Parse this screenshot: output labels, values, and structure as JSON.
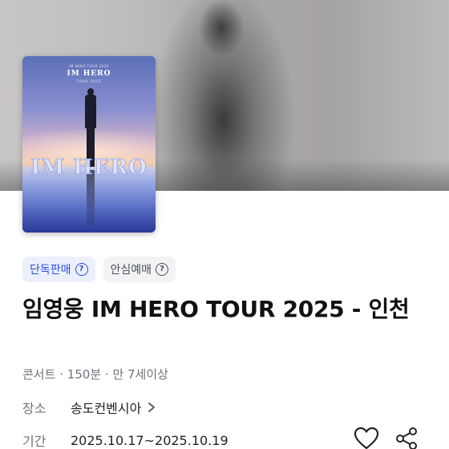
{
  "poster": {
    "top_line": "IM HERO TOUR 2025",
    "title_top": "IM HERO",
    "subtitle": "TOUR 2025",
    "title_big": "IM HERO"
  },
  "badges": {
    "exclusive_label": "단독판매",
    "safe_label": "안심예매"
  },
  "concert": {
    "title": "임영웅 IM HERO TOUR 2025 - 인천",
    "meta": "콘서트 · 150분 · 만 7세이상"
  },
  "info": {
    "place_label": "장소",
    "place_value": "송도컨벤시아",
    "period_label": "기간",
    "period_value": "2025.10.17~2025.10.19"
  },
  "colors": {
    "accent": "#2a4fdc",
    "title_text": "#111111",
    "secondary_text": "#6f737a"
  },
  "icons": {
    "heart": "heart-icon",
    "share": "share-icon",
    "help": "question-circle-icon",
    "chevron": "chevron-right-icon"
  }
}
